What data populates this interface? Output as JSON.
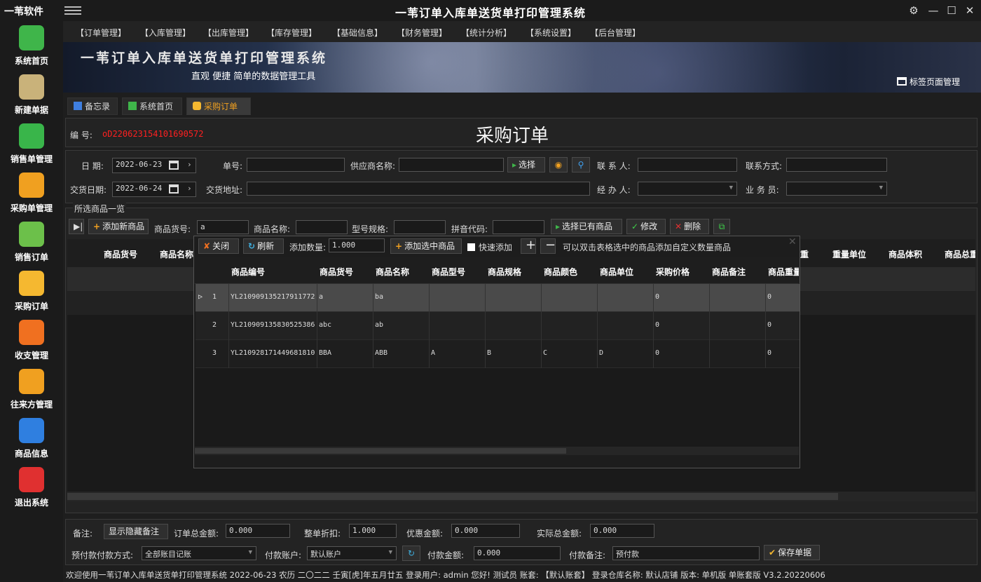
{
  "window": {
    "brand": "一苇软件",
    "title": "一苇订单入库单送货单打印管理系统",
    "controls": [
      "⚙",
      "—",
      "☐",
      "✕"
    ]
  },
  "sidebar": {
    "items": [
      {
        "label": "系统首页",
        "color": "#3fb54a"
      },
      {
        "label": "新建单据",
        "color": "#c9b27a"
      },
      {
        "label": "销售单管理",
        "color": "#39b54a"
      },
      {
        "label": "采购单管理",
        "color": "#f0a020"
      },
      {
        "label": "销售订单",
        "color": "#6cc04a"
      },
      {
        "label": "采购订单",
        "color": "#f5b830"
      },
      {
        "label": "收支管理",
        "color": "#f07020"
      },
      {
        "label": "往来方管理",
        "color": "#f0a020"
      },
      {
        "label": "商品信息",
        "color": "#2f7fe0"
      },
      {
        "label": "退出系统",
        "color": "#e03030"
      }
    ]
  },
  "topmenu": [
    "【订单管理】",
    "【入库管理】",
    "【出库管理】",
    "【库存管理】",
    "【基础信息】",
    "【财务管理】",
    "【统计分析】",
    "【系统设置】",
    "【后台管理】"
  ],
  "banner": {
    "title": "一苇订单入库单送货单打印管理系统",
    "subtitle": "直观 便捷 简单的数据管理工具",
    "tab_manage": "标签页面管理"
  },
  "tabs": [
    "备忘录",
    "系统首页",
    "采购订单"
  ],
  "form": {
    "no_label": "编 号:",
    "no_value": "oD220623154101690572",
    "page_title": "采购订单",
    "date_label": "日 期:",
    "date_value": "2022-06-23",
    "order_no_label": "单号:",
    "supplier_label": "供应商名称:",
    "select_btn": "选择",
    "contact_label": "联 系 人:",
    "contact_way_label": "联系方式:",
    "delivery_date_label": "交货日期:",
    "delivery_date_value": "2022-06-24",
    "address_label": "交货地址:",
    "handler_label": "经 办 人:",
    "salesman_label": "业 务 员:"
  },
  "goods": {
    "section_title": "所选商品一览",
    "add_btn": "添加新商品",
    "code_label": "商品货号:",
    "code_value": "a",
    "name_label": "商品名称:",
    "spec_label": "型号规格:",
    "pinyin_label": "拼音代码:",
    "select_existing": "选择已有商品",
    "edit": "修改",
    "delete": "删除",
    "columns": [
      "商品货号",
      "商品名称",
      "重",
      "重量单位",
      "商品体积",
      "商品总重"
    ]
  },
  "popup": {
    "close": "关闭",
    "refresh": "刷新",
    "qty_label": "添加数量:",
    "qty_value": "1.000",
    "add_selected": "添加选中商品",
    "quick_add": "快速添加",
    "hint": "可以双击表格选中的商品添加自定义数量商品",
    "columns": [
      "商品编号",
      "商品货号",
      "商品名称",
      "商品型号",
      "商品规格",
      "商品颜色",
      "商品单位",
      "采购价格",
      "商品备注",
      "商品重量"
    ],
    "rows": [
      {
        "idx": "1",
        "cells": [
          "YL210909135217911772",
          "a",
          "ba",
          "",
          "",
          "",
          "",
          "0",
          "",
          "0"
        ]
      },
      {
        "idx": "2",
        "cells": [
          "YL210909135830525386",
          "abc",
          "ab",
          "",
          "",
          "",
          "",
          "0",
          "",
          "0"
        ]
      },
      {
        "idx": "3",
        "cells": [
          "YL210928171449681810",
          "BBA",
          "ABB",
          "A",
          "B",
          "C",
          "D",
          "0",
          "",
          "0"
        ]
      }
    ]
  },
  "footer": {
    "remark_label": "备注:",
    "toggle_remark": "显示隐藏备注",
    "total_label": "订单总金额:",
    "total_value": "0.000",
    "discount_label": "整单折扣:",
    "discount_value": "1.000",
    "coupon_label": "优惠金额:",
    "coupon_value": "0.000",
    "actual_label": "实际总金额:",
    "actual_value": "0.000",
    "prepay_label": "预付款付款方式:",
    "prepay_value": "全部账目记账",
    "account_label": "付款账户:",
    "account_value": "默认账户",
    "pay_amount_label": "付款金额:",
    "pay_amount_value": "0.000",
    "pay_remark_label": "付款备注:",
    "pay_remark_value": "预付款",
    "save_btn": "保存单据"
  },
  "status": "欢迎使用一苇订单入库单送货单打印管理系统 2022-06-23 农历 二〇二二 壬寅[虎]年五月廿五 登录用户: admin 您好! 测试员 账套: 【默认账套】 登录仓库名称: 默认店铺 版本: 单机版 单账套版 V3.2.20220606"
}
